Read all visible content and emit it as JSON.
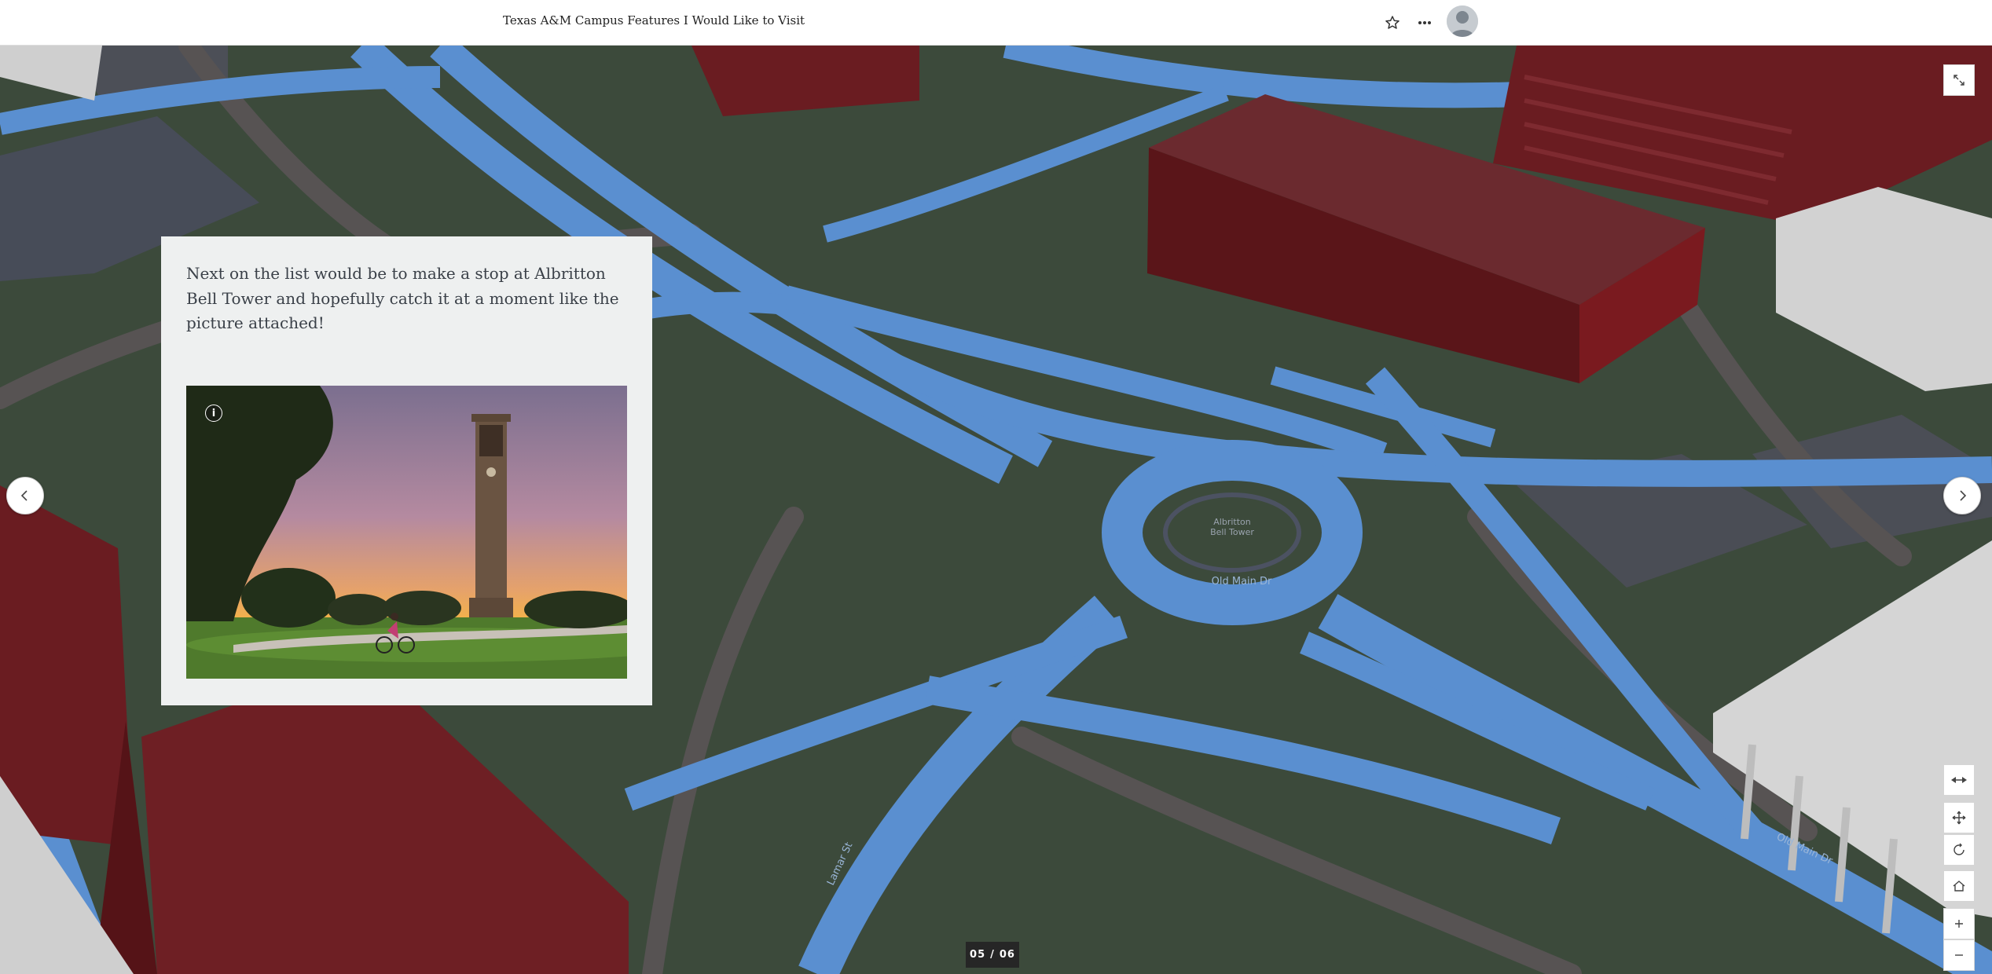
{
  "header": {
    "title": "Texas A&M Campus Features I Would Like to Visit",
    "favorite_icon": "star-icon",
    "more_icon": "more-horizontal-icon",
    "avatar_icon": "user-avatar-icon"
  },
  "panel": {
    "text": "Next on the list would be to make a stop at Albritton Bell Tower and hopefully catch it at a moment like the picture attached!",
    "image_alt": "Albritton Bell Tower at sunset with a cyclist",
    "info_label": "i"
  },
  "map": {
    "labels": {
      "bell_tower": "Albritton Bell Tower",
      "old_main_dr": "Old Main Dr",
      "lamar_st": "Lamar St"
    },
    "colors": {
      "ground": "#3c4a3b",
      "roads": "#5a8fd0",
      "buildings_red": "#6e1f24",
      "buildings_white": "#d7d7d7"
    }
  },
  "controls": {
    "fullscreen_icon": "expand-icon",
    "prev_icon": "chevron-left-icon",
    "next_icon": "chevron-right-icon",
    "map_buttons": [
      "toggle-2d-3d-icon",
      "pan-icon",
      "rotate-icon",
      "home-icon",
      "zoom-in-icon",
      "zoom-out-icon"
    ]
  },
  "pager": {
    "current": "05",
    "separator": "/",
    "total": "06"
  }
}
